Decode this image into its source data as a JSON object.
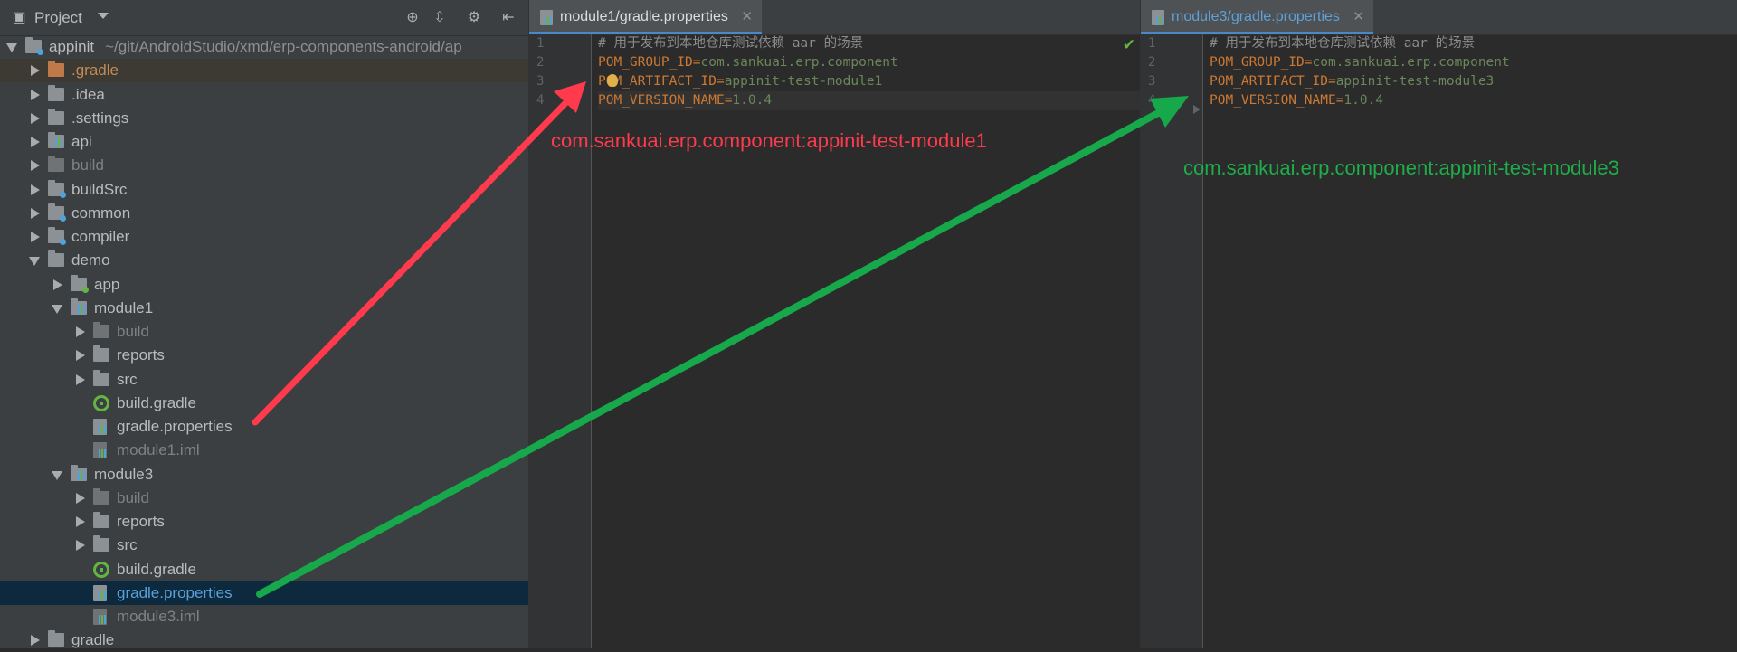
{
  "project_panel": {
    "title": "Project",
    "toolbar_icons": [
      "target-icon",
      "collapse-all-icon",
      "gear-icon",
      "hide-panel-icon"
    ],
    "tree": [
      {
        "label": "appinit",
        "path": "~/git/AndroidStudio/xmd/erp-components-android/ap",
        "level": 0,
        "expanded": true,
        "icon": "module-folder",
        "style": "normal"
      },
      {
        "label": ".gradle",
        "level": 1,
        "expanded": false,
        "icon": "folder-orange",
        "style": "orange"
      },
      {
        "label": ".idea",
        "level": 1,
        "expanded": false,
        "icon": "folder",
        "style": "normal"
      },
      {
        "label": ".settings",
        "level": 1,
        "expanded": false,
        "icon": "folder",
        "style": "normal"
      },
      {
        "label": "api",
        "level": 1,
        "expanded": false,
        "icon": "module",
        "style": "normal"
      },
      {
        "label": "build",
        "level": 1,
        "expanded": false,
        "icon": "folder-dim",
        "style": "dim"
      },
      {
        "label": "buildSrc",
        "level": 1,
        "expanded": false,
        "icon": "folder-source",
        "style": "normal"
      },
      {
        "label": "common",
        "level": 1,
        "expanded": false,
        "icon": "folder-source",
        "style": "normal"
      },
      {
        "label": "compiler",
        "level": 1,
        "expanded": false,
        "icon": "folder-source",
        "style": "normal"
      },
      {
        "label": "demo",
        "level": 1,
        "expanded": true,
        "icon": "folder",
        "style": "normal"
      },
      {
        "label": "app",
        "level": 2,
        "expanded": false,
        "icon": "folder-app",
        "style": "normal"
      },
      {
        "label": "module1",
        "level": 2,
        "expanded": true,
        "icon": "module",
        "style": "normal"
      },
      {
        "label": "build",
        "level": 3,
        "expanded": false,
        "icon": "folder-dim",
        "style": "dim"
      },
      {
        "label": "reports",
        "level": 3,
        "expanded": false,
        "icon": "folder",
        "style": "normal"
      },
      {
        "label": "src",
        "level": 3,
        "expanded": false,
        "icon": "folder",
        "style": "normal"
      },
      {
        "label": "build.gradle",
        "level": 3,
        "icon": "gradle",
        "style": "normal"
      },
      {
        "label": "gradle.properties",
        "level": 3,
        "icon": "properties",
        "style": "normal"
      },
      {
        "label": "module1.iml",
        "level": 3,
        "icon": "iml",
        "style": "dim"
      },
      {
        "label": "module3",
        "level": 2,
        "expanded": true,
        "icon": "module",
        "style": "normal"
      },
      {
        "label": "build",
        "level": 3,
        "expanded": false,
        "icon": "folder-dim",
        "style": "dim"
      },
      {
        "label": "reports",
        "level": 3,
        "expanded": false,
        "icon": "folder",
        "style": "normal"
      },
      {
        "label": "src",
        "level": 3,
        "expanded": false,
        "icon": "folder",
        "style": "normal"
      },
      {
        "label": "build.gradle",
        "level": 3,
        "icon": "gradle",
        "style": "normal"
      },
      {
        "label": "gradle.properties",
        "level": 3,
        "icon": "properties",
        "style": "link",
        "selected": true
      },
      {
        "label": "module3.iml",
        "level": 3,
        "icon": "iml",
        "style": "dim"
      },
      {
        "label": "gradle",
        "level": 1,
        "expanded": false,
        "icon": "folder",
        "style": "normal"
      }
    ]
  },
  "editors": [
    {
      "tab": "module1/gradle.properties",
      "line_numbers": [
        "1",
        "2",
        "3",
        "4"
      ],
      "lines": [
        {
          "comment": "# 用于发布到本地仓库测试依赖 aar 的场景"
        },
        {
          "key": "POM_GROUP_ID",
          "eq": "=",
          "value": "com.sankuai.erp.component"
        },
        {
          "key": "POM_ARTIFACT_ID",
          "eq": "=",
          "value": "appinit-test-module1"
        },
        {
          "key": "POM_VERSION_NAME",
          "eq": "=",
          "value": "1.0.4"
        }
      ],
      "annotation": "com.sankuai.erp.component:appinit-test-module1",
      "annotation_color": "#ff3a4c"
    },
    {
      "tab": "module3/gradle.properties",
      "line_numbers": [
        "1",
        "2",
        "3",
        "4"
      ],
      "lines": [
        {
          "comment": "# 用于发布到本地仓库测试依赖 aar 的场景"
        },
        {
          "key": "POM_GROUP_ID",
          "eq": "=",
          "value": "com.sankuai.erp.component"
        },
        {
          "key": "POM_ARTIFACT_ID",
          "eq": "=",
          "value": "appinit-test-module3"
        },
        {
          "key": "POM_VERSION_NAME",
          "eq": "=",
          "value": "1.0.4"
        }
      ],
      "annotation": "com.sankuai.erp.component:appinit-test-module3",
      "annotation_color": "#1fad4a"
    }
  ],
  "colors": {
    "red_arrow": "#ff3a4c",
    "green_arrow": "#16a84a"
  }
}
